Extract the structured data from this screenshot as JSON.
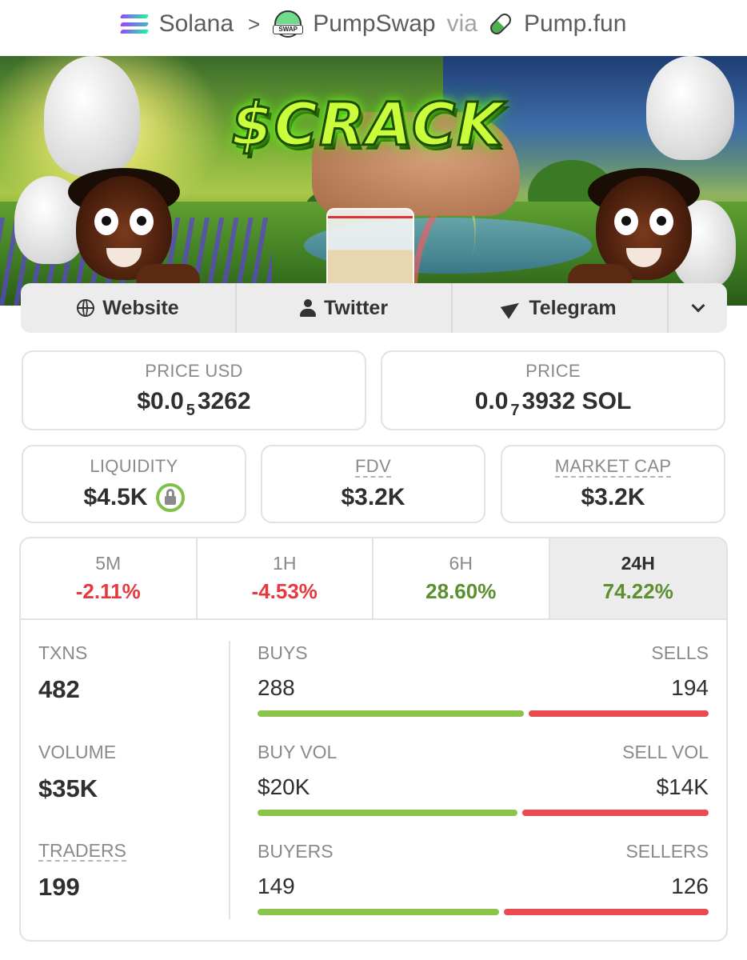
{
  "breadcrumb": {
    "chain": "Solana",
    "separator": ">",
    "dex": "PumpSwap",
    "via": "via",
    "launchpad": "Pump.fun"
  },
  "banner": {
    "title": "$CRACK"
  },
  "links": {
    "website": "Website",
    "twitter": "Twitter",
    "telegram": "Telegram"
  },
  "price_usd": {
    "label": "PRICE USD",
    "prefix": "$0.0",
    "zeros": "5",
    "digits": "3262"
  },
  "price_native": {
    "label": "PRICE",
    "prefix": "0.0",
    "zeros": "7",
    "digits": "3932 SOL"
  },
  "liquidity": {
    "label": "LIQUIDITY",
    "value": "$4.5K"
  },
  "fdv": {
    "label": "FDV",
    "value": "$3.2K"
  },
  "market_cap": {
    "label": "MARKET CAP",
    "value": "$3.2K"
  },
  "timeframes": [
    {
      "label": "5M",
      "change": "-2.11%",
      "trend": "negative"
    },
    {
      "label": "1H",
      "change": "-4.53%",
      "trend": "negative"
    },
    {
      "label": "6H",
      "change": "28.60%",
      "trend": "positive"
    },
    {
      "label": "24H",
      "change": "74.22%",
      "trend": "positive",
      "selected": true
    }
  ],
  "stats": {
    "txns": {
      "label": "TXNS",
      "value": "482"
    },
    "volume": {
      "label": "VOLUME",
      "value": "$35K"
    },
    "traders": {
      "label": "TRADERS",
      "value": "199"
    }
  },
  "splits": {
    "txns": {
      "left_label": "BUYS",
      "right_label": "SELLS",
      "left_value": "288",
      "right_value": "194",
      "buy_share": 0.597
    },
    "volume": {
      "left_label": "BUY VOL",
      "right_label": "SELL VOL",
      "left_value": "$20K",
      "right_value": "$14K",
      "buy_share": 0.583
    },
    "traders": {
      "left_label": "BUYERS",
      "right_label": "SELLERS",
      "left_value": "149",
      "right_value": "126",
      "buy_share": 0.542
    }
  },
  "colors": {
    "positive": "#5c8f2f",
    "negative": "#e5393f",
    "buy_bar": "#8cc34a",
    "sell_bar": "#e84a4f"
  }
}
